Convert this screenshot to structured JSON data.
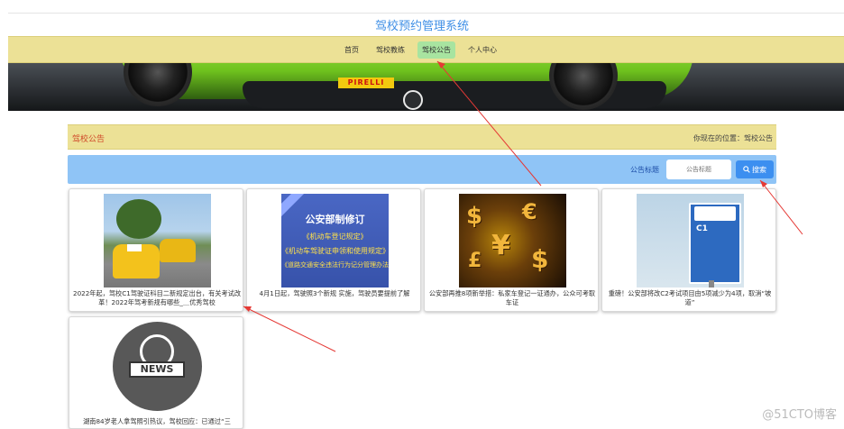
{
  "site": {
    "title": "驾校预约管理系统"
  },
  "nav": {
    "items": [
      {
        "label": "首页",
        "active": false
      },
      {
        "label": "驾校教练",
        "active": false
      },
      {
        "label": "驾校公告",
        "active": true
      },
      {
        "label": "个人中心",
        "active": false
      }
    ]
  },
  "banner": {
    "brand_text": "PIRELLI"
  },
  "section": {
    "title": "驾校公告",
    "location": "你现在的位置：驾校公告"
  },
  "search": {
    "label": "公告标题",
    "placeholder": "公告标题",
    "button_label": "搜索",
    "button_icon": "search-icon"
  },
  "announcements": [
    {
      "text": "2022年起，驾校C1驾驶证科目二新规定出台，有关考试改革！2022年驾考新规有哪些_＿优秀驾校"
    },
    {
      "text": "4月1日起，驾驶照3个新规 实施，驾驶员要提前了解",
      "thumb_lines": [
        "公安部制修订",
        "《机动车登记规定》",
        "《机动车驾驶证申领和使用规定》",
        "《道路交通安全违法行为记分管理办法》"
      ]
    },
    {
      "text": "公安部再推8项新举措：私家车登记一证通办，公众可考取车证"
    },
    {
      "text": "重磅！公安部将改C2考试项目由5项减少为4项，取消“坡道”",
      "thumb_sign": "C1"
    },
    {
      "text": "湖南84岁老人拿驾照引热议，驾校回应：已通过“三",
      "thumb_label": "NEWS"
    }
  ],
  "watermark": "@51CTO博客",
  "colors": {
    "accent_blue": "#3f8fe6",
    "nav_bg": "#ece196",
    "active_nav": "#a8e4a0",
    "search_bar": "#8fc4f6",
    "section_title": "#d04a2a",
    "arrow": "#e53935"
  }
}
